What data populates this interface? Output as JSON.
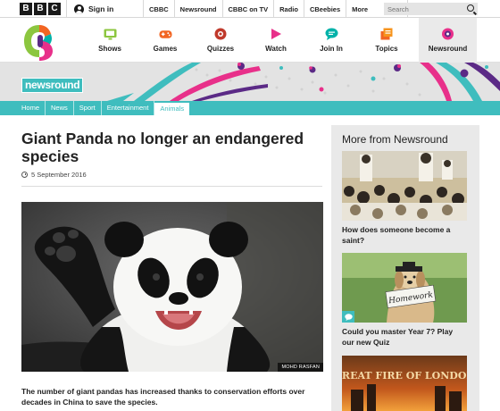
{
  "bbc_bar": {
    "logo_letters": [
      "B",
      "B",
      "C"
    ],
    "signin_label": "Sign in",
    "links": [
      {
        "label": "CBBC",
        "dropdown": false
      },
      {
        "label": "Newsround",
        "dropdown": false
      },
      {
        "label": "CBBC on TV",
        "dropdown": false
      },
      {
        "label": "Radio",
        "dropdown": false
      },
      {
        "label": "CBeebies",
        "dropdown": false
      },
      {
        "label": "More",
        "dropdown": true
      }
    ],
    "search_placeholder": "Search"
  },
  "cbbc_nav": {
    "items": [
      {
        "label": "Shows",
        "icon": "tv-icon",
        "color": "#8cc63f"
      },
      {
        "label": "Games",
        "icon": "gamepad-icon",
        "color": "#f26522"
      },
      {
        "label": "Quizzes",
        "icon": "quiz-icon",
        "color": "#c0392b"
      },
      {
        "label": "Watch",
        "icon": "play-icon",
        "color": "#e8308a"
      },
      {
        "label": "Join In",
        "icon": "chat-icon",
        "color": "#00b2a9"
      },
      {
        "label": "Topics",
        "icon": "topics-icon",
        "color": "#f26522"
      },
      {
        "label": "Newsround",
        "icon": "newsround-icon",
        "color": "#e8308a",
        "active": true
      }
    ]
  },
  "banner": {
    "logo_text": "newsround"
  },
  "section_nav": {
    "items": [
      "Home",
      "News",
      "Sport",
      "Entertainment",
      "Animals"
    ],
    "active": "Animals"
  },
  "article": {
    "title": "Giant Panda no longer an endangered species",
    "date": "5 September 2016",
    "image_credit": "MOHD RASFAN",
    "summary": "The number of giant pandas has increased thanks to conservation efforts over decades in China to save the species."
  },
  "sidebar": {
    "title": "More from Newsround",
    "promos": [
      {
        "caption": "How does someone become a saint?",
        "thumb": "saint-crowd-image"
      },
      {
        "caption": "Could you master Year 7? Play our new Quiz",
        "thumb": "homework-dog-image",
        "sign_text": "Homework"
      },
      {
        "caption": "",
        "thumb": "great-fire-image",
        "sign_text": "GREAT FIRE OF LONDON"
      }
    ]
  },
  "colors": {
    "teal": "#3fbdbe",
    "banner_grey": "#e3e3e3",
    "sidebar_grey": "#e9e9e9"
  }
}
